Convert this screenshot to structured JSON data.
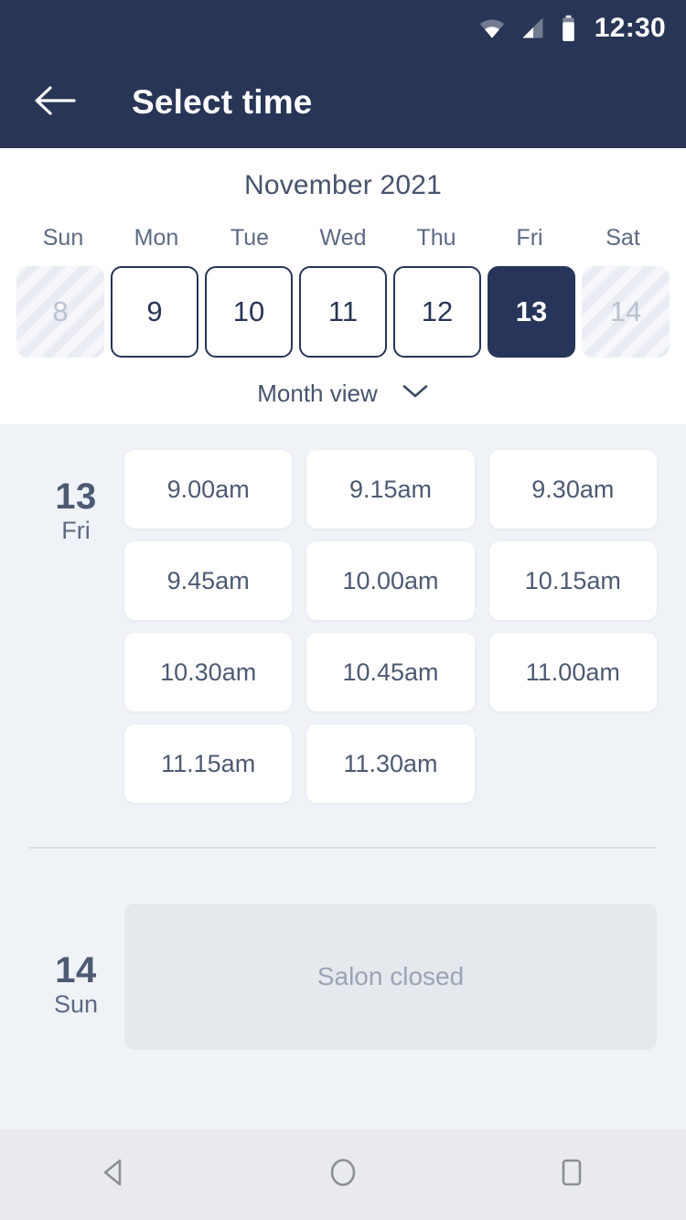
{
  "status_bar": {
    "time": "12:30",
    "wifi_icon": "wifi-icon",
    "signal_icon": "cell-signal-icon",
    "battery_icon": "battery-icon"
  },
  "app_bar": {
    "back_icon": "back-arrow-icon",
    "title": "Select time"
  },
  "calendar": {
    "month_title": "November 2021",
    "weekdays": [
      "Sun",
      "Mon",
      "Tue",
      "Wed",
      "Thu",
      "Fri",
      "Sat"
    ],
    "dates": [
      {
        "day": "8",
        "state": "disabled"
      },
      {
        "day": "9",
        "state": "available"
      },
      {
        "day": "10",
        "state": "available"
      },
      {
        "day": "11",
        "state": "available"
      },
      {
        "day": "12",
        "state": "available"
      },
      {
        "day": "13",
        "state": "selected"
      },
      {
        "day": "14",
        "state": "disabled"
      }
    ],
    "view_toggle_label": "Month view",
    "view_toggle_icon": "chevron-down-icon"
  },
  "days": [
    {
      "day_number": "13",
      "day_of_week": "Fri",
      "slots": [
        "9.00am",
        "9.15am",
        "9.30am",
        "9.45am",
        "10.00am",
        "10.15am",
        "10.30am",
        "10.45am",
        "11.00am",
        "11.15am",
        "11.30am"
      ]
    },
    {
      "day_number": "14",
      "day_of_week": "Sun",
      "closed_message": "Salon closed"
    }
  ],
  "nav_bar": {
    "back_icon": "nav-back-triangle-icon",
    "home_icon": "nav-home-circle-icon",
    "recents_icon": "nav-recents-square-icon"
  },
  "colors": {
    "header_navy": "#283556",
    "selected_navy": "#27355a",
    "body_background": "#eff2f7",
    "slot_white": "#ffffff",
    "closed_grey": "#e5e8ed",
    "text_slate": "#4d5a72"
  }
}
